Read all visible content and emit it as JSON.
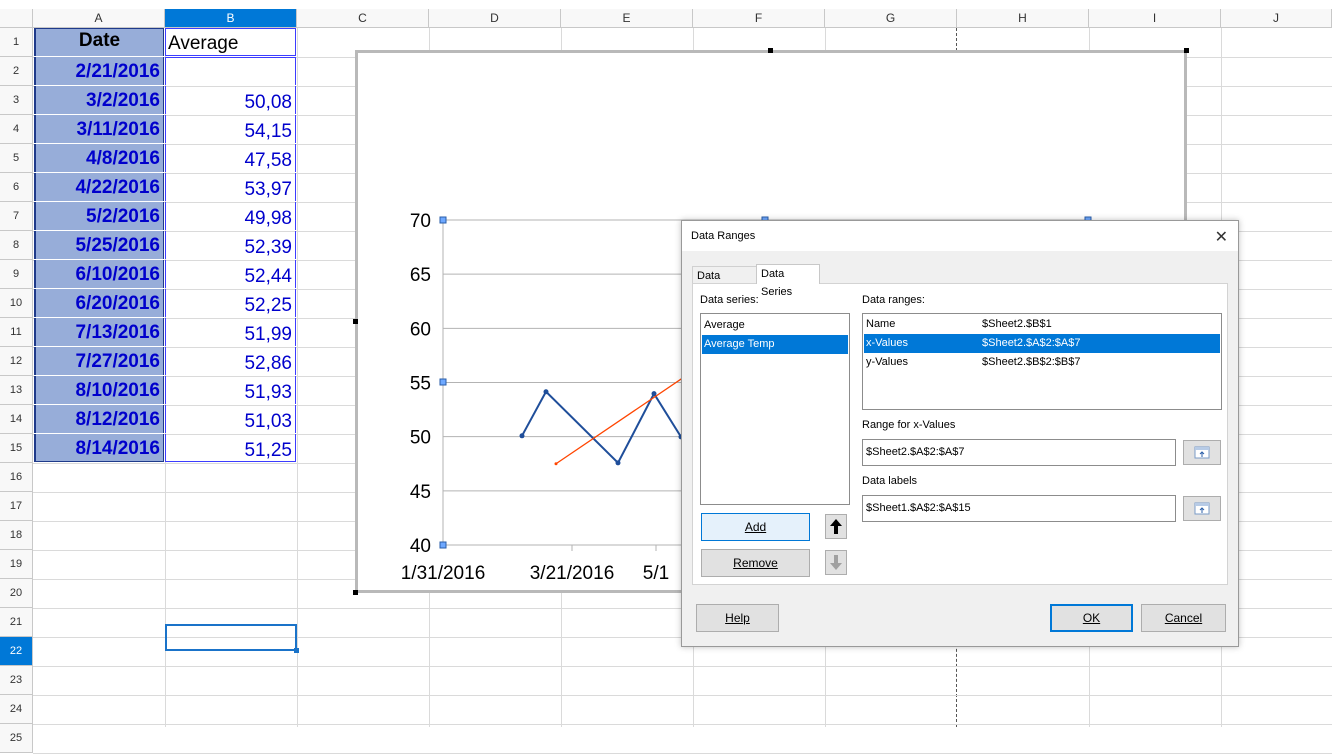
{
  "columns": [
    "A",
    "B",
    "C",
    "D",
    "E",
    "F",
    "G",
    "H",
    "I",
    "J"
  ],
  "rows": [
    "1",
    "2",
    "3",
    "4",
    "5",
    "6",
    "7",
    "8",
    "9",
    "10",
    "11",
    "12",
    "13",
    "14",
    "15",
    "16",
    "17",
    "18",
    "19",
    "20",
    "21",
    "22",
    "23",
    "24",
    "25"
  ],
  "header": {
    "date": "Date",
    "average": "Average"
  },
  "dates": [
    "2/21/2016",
    "3/2/2016",
    "3/11/2016",
    "4/8/2016",
    "4/22/2016",
    "5/2/2016",
    "5/25/2016",
    "6/10/2016",
    "6/20/2016",
    "7/13/2016",
    "7/27/2016",
    "8/10/2016",
    "8/12/2016",
    "8/14/2016"
  ],
  "averages": [
    "",
    "50,08",
    "54,15",
    "47,58",
    "53,97",
    "49,98",
    "52,39",
    "52,44",
    "52,25",
    "51,99",
    "52,86",
    "51,93",
    "51,03",
    "51,25"
  ],
  "chart_data": {
    "type": "line",
    "y_ticks": [
      "70",
      "65",
      "60",
      "55",
      "50",
      "45",
      "40"
    ],
    "x_ticks": [
      "1/31/2016",
      "3/21/2016",
      "5/1"
    ],
    "ylim": [
      40,
      70
    ],
    "series": [
      {
        "values": [
          50.08,
          54.15,
          47.58,
          53.97,
          49.98
        ],
        "color": "#1f4e9a"
      },
      {
        "values": [
          47.5,
          55.5
        ],
        "color": "#ff4500"
      }
    ]
  },
  "dialog": {
    "title": "Data Ranges",
    "close": "✕",
    "tabs": {
      "data_range": "Data Range",
      "data_series": "Data Series"
    },
    "data_series_label": "Data series:",
    "series": [
      "Average",
      "Average Temp"
    ],
    "data_ranges_label": "Data ranges:",
    "ranges": [
      {
        "role": "Name",
        "range": "$Sheet2.$B$1"
      },
      {
        "role": "x-Values",
        "range": "$Sheet2.$A$2:$A$7"
      },
      {
        "role": "y-Values",
        "range": "$Sheet2.$B$2:$B$7"
      }
    ],
    "range_for_label": "Range for x-Values",
    "range_for_value": "$Sheet2.$A$2:$A$7",
    "data_labels_label": "Data labels",
    "data_labels_value": "$Sheet1.$A$2:$A$15",
    "add": "Add",
    "remove": "Remove",
    "help": "Help",
    "ok": "OK",
    "cancel": "Cancel"
  }
}
